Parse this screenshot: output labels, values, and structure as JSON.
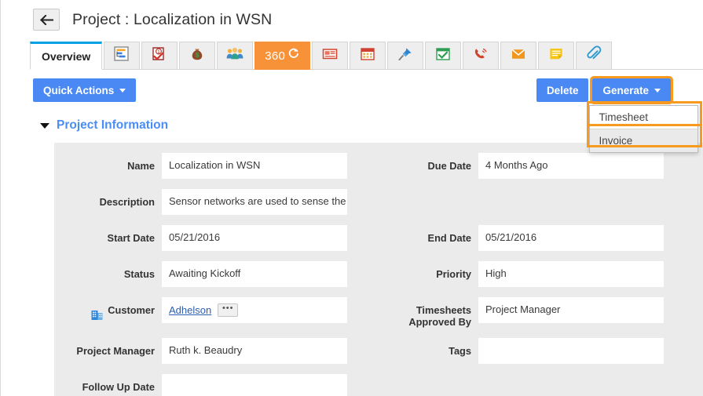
{
  "header": {
    "back_icon": "back-arrow-icon",
    "title": "Project : Localization in WSN"
  },
  "tabs": [
    {
      "label": "Overview",
      "icon": "overview-tab",
      "active": true
    },
    {
      "label": "",
      "icon": "gantt-chart-icon",
      "active": false
    },
    {
      "label": "",
      "icon": "task-checklist-icon",
      "active": false
    },
    {
      "label": "",
      "icon": "money-bag-icon",
      "active": false
    },
    {
      "label": "",
      "icon": "team-people-icon",
      "active": false
    },
    {
      "label": "360",
      "icon": "refresh-360-icon",
      "active": false,
      "accent": true
    },
    {
      "label": "",
      "icon": "newspaper-icon",
      "active": false
    },
    {
      "label": "",
      "icon": "calendar-icon",
      "active": false
    },
    {
      "label": "",
      "icon": "pushpin-icon",
      "active": false
    },
    {
      "label": "",
      "icon": "calendar-check-icon",
      "active": false
    },
    {
      "label": "",
      "icon": "phone-ringing-icon",
      "active": false
    },
    {
      "label": "",
      "icon": "envelope-icon",
      "active": false
    },
    {
      "label": "",
      "icon": "sticky-note-icon",
      "active": false
    },
    {
      "label": "",
      "icon": "paperclip-icon",
      "active": false
    }
  ],
  "toolbar": {
    "quick_actions_label": "Quick Actions",
    "delete_label": "Delete",
    "generate_label": "Generate"
  },
  "generate_menu": {
    "open": true,
    "items": [
      {
        "label": "Timesheet",
        "highlighted": true
      },
      {
        "label": "Invoice",
        "highlighted": false
      }
    ]
  },
  "section": {
    "title": "Project Information",
    "expanded": true
  },
  "fields": {
    "name": {
      "label": "Name",
      "value": "Localization in WSN"
    },
    "due_date": {
      "label": "Due Date",
      "value": "4 Months Ago"
    },
    "description": {
      "label": "Description",
      "value": "Sensor networks are used to sense the entire physical environment"
    },
    "start_date": {
      "label": "Start Date",
      "value": "05/21/2016"
    },
    "end_date": {
      "label": "End Date",
      "value": "05/21/2016"
    },
    "status": {
      "label": "Status",
      "value": "Awaiting Kickoff"
    },
    "priority": {
      "label": "Priority",
      "value": "High"
    },
    "customer": {
      "label": "Customer",
      "value": "Adhelson",
      "more_label": "•••",
      "icon": "building-icon"
    },
    "timesheets_approved_by": {
      "label": "Timesheets Approved By",
      "value": "Project Manager"
    },
    "project_manager": {
      "label": "Project Manager",
      "value": "Ruth k. Beaudry"
    },
    "tags": {
      "label": "Tags",
      "value": ""
    },
    "follow_up_date": {
      "label": "Follow Up Date",
      "value": ""
    }
  },
  "colors": {
    "primary_blue": "#4a89f3",
    "active_tab_blue": "#00a1e4",
    "link_blue": "#2a5db0",
    "section_blue": "#4a8ef5",
    "accent_orange": "#f79239",
    "highlight_orange": "#f79a1f",
    "panel_gray": "#ebebeb"
  }
}
